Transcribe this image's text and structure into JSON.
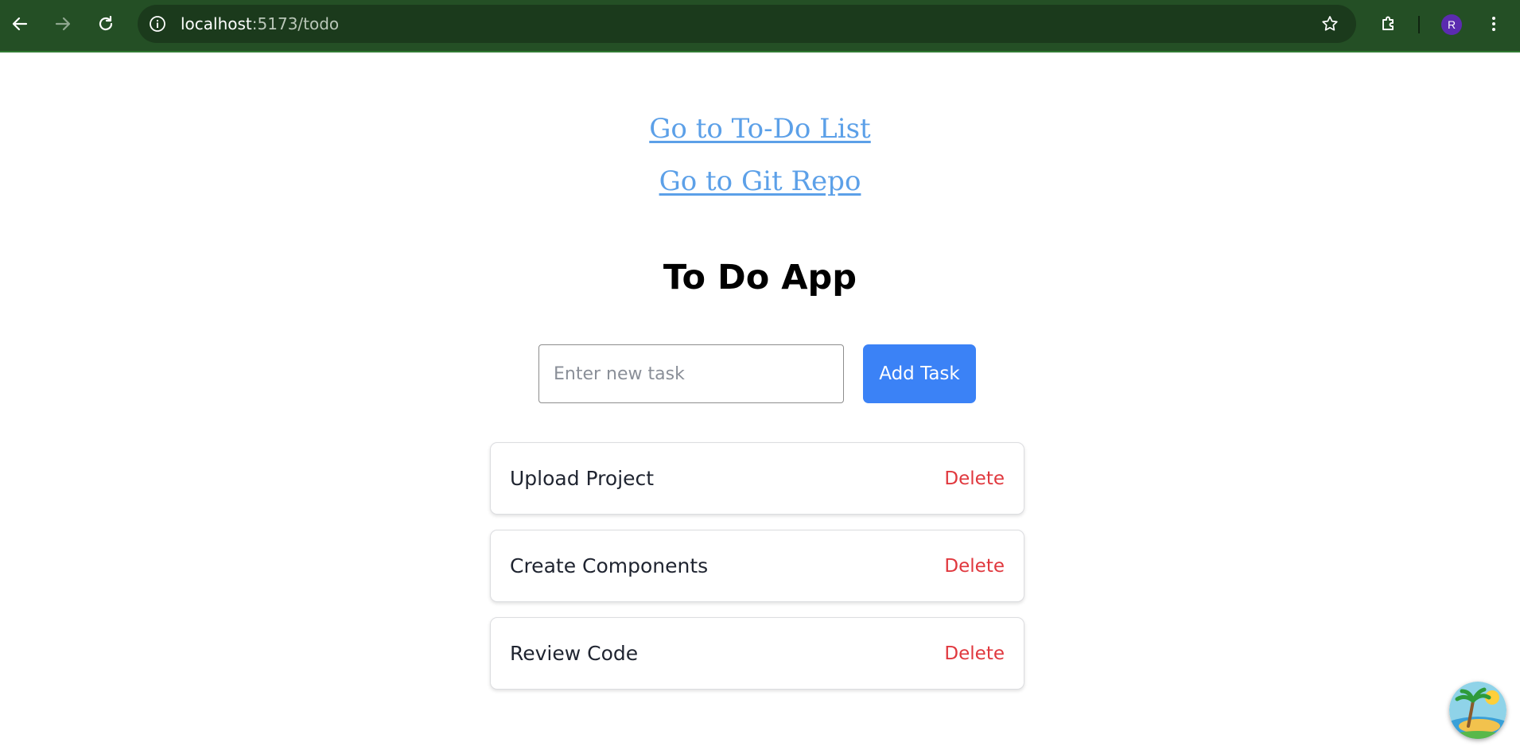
{
  "browser": {
    "url_host": "localhost",
    "url_path": ":5173/todo",
    "avatar_letter": "R",
    "icons": [
      "back-arrow-icon",
      "forward-arrow-icon",
      "reload-icon",
      "site-info-icon",
      "bookmark-star-icon",
      "extensions-puzzle-icon",
      "kebab-menu-icon"
    ],
    "theme_color": "#244f25"
  },
  "links": {
    "todo_list": "Go to To-Do List",
    "git_repo": "Go to Git Repo"
  },
  "app": {
    "title": "To Do App",
    "input_placeholder": "Enter new task",
    "add_button": "Add Task",
    "accent_color": "#3b82f6",
    "delete_color": "#e0383e"
  },
  "tasks": [
    {
      "text": "Upload Project",
      "action": "Delete"
    },
    {
      "text": "Create Components",
      "action": "Delete"
    },
    {
      "text": "Review Code",
      "action": "Delete"
    }
  ],
  "floating_widget": {
    "icon": "beach-island-icon"
  }
}
